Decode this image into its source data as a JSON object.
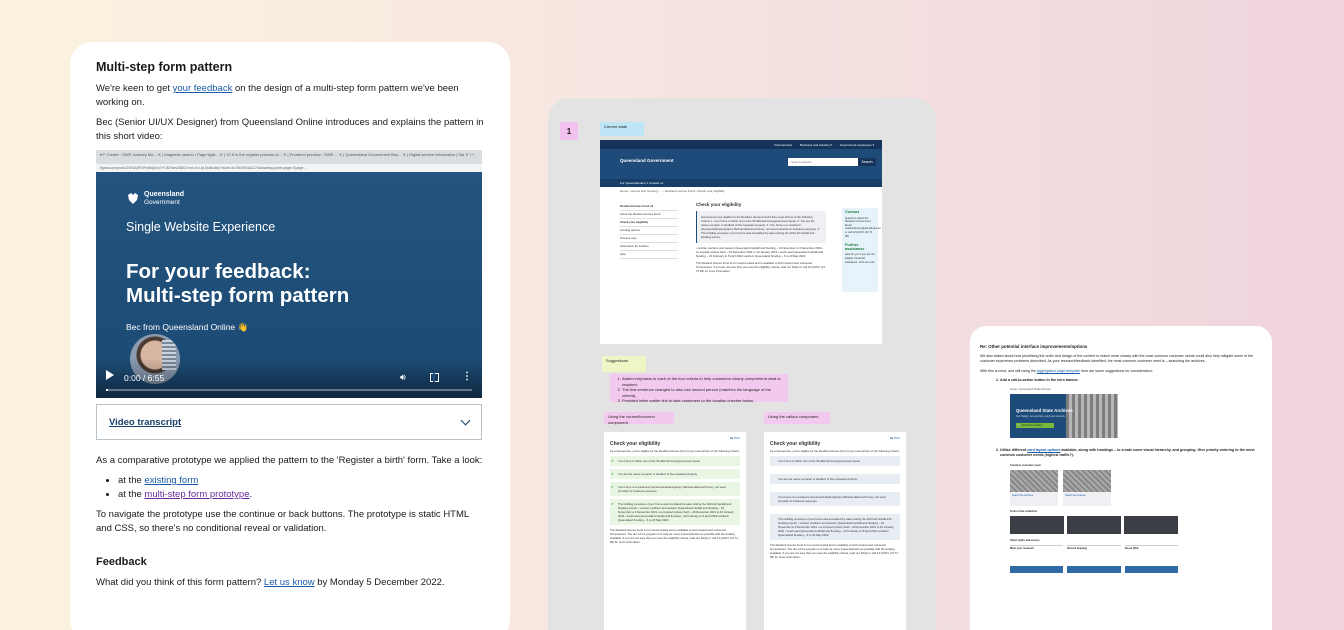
{
  "left_card": {
    "heading": "Multi-step form pattern",
    "intro_before_link": "We're keen to get ",
    "intro_link": "your feedback",
    "intro_after_link": " on the design of a multi-step form pattern we've been working on.",
    "bec_paragraph": "Bec (Senior UI/UX Designer) from Queensland Online introduces and explains the pattern in this short video:",
    "video": {
      "browser_tabs": "▾ F Create - SWE Journey Mo...  ✕ | Magnetic search / Page tight... ✕ | 12 ft in the register process st... ✕ | Frontend preview - SWE ... ✕ | Queensland Government Bus... ✕ | Digital service information | Sta ✕ | +",
      "url": "figma.com/proto/ZSKAQRXlFmtMy2uVVYJ6/Tabs2580-Form-in-Up-Multi-step?node-id=3604%3A1274&starting-point=page=Spage…",
      "crest_name": "Queensland",
      "crest_gov": "Government",
      "subtitle": "Single Website Experience",
      "title_line1": "For your feedback:",
      "title_line2": "Multi-step form pattern",
      "presenter": "Bec from Queensland Online 👋",
      "time": "0:00 / 6:55",
      "progress": 0.0
    },
    "transcript_label": "Video transcript",
    "comparative": "As a comparative prototype we applied the pattern to the 'Register a birth' form. Take a look:",
    "bullets": [
      {
        "prefix": "at the ",
        "link": "existing form",
        "suffix": ""
      },
      {
        "prefix": "at the ",
        "link": "multi-step form prototype",
        "suffix": "."
      }
    ],
    "navigate_text": "To navigate the prototype use the continue or back buttons. The prototype is static HTML and CSS, so there's no conditional reveal or validation.",
    "feedback_heading": "Feedback",
    "feedback_before": "What did you think of this form pattern? ",
    "feedback_link": "Let us know",
    "feedback_after": " by Monday 5 December 2022."
  },
  "board": {
    "step_number": "1",
    "sticky_current": "Current state",
    "site": {
      "top_links": [
        "Find services",
        "Business and industry ▾",
        "Government employees ▾"
      ],
      "logo": "Queensland Government",
      "search_placeholder": "Search website",
      "search_button": "Search",
      "nav": "For Queenslanders ▾     Contact us",
      "breadcrumb": "Home  ›  Homes and housing  ›  ...  ›  Resilient Homes Fund  ›  Check your eligibility",
      "side_items": [
        "Resilient Homes Fund v2",
        "About the Resilient Homes Fund",
        "Check your eligibility",
        "Funding options",
        "Process map",
        "Information for builders",
        "Help"
      ],
      "main_heading": "Check your eligibility",
      "main_info": "Homeowners are eligible for the Resilient Homes Fund if they meet all four of the following criteria: 1. Your home is within one of the 39 affected local government areas. 2. You are the owner-occupier or landlord of the impacted property. 3. Your home is a residence (house/unit/duplex/granny flat/manufactured home), not used primarily for business purposes. 4. The building envelope of your home was inundated by water during the 2021-22 rainfall and flooding events.",
      "main_bullets": "• central, southern and western Queensland rainfall and flooding – 10 November to 3 December 2021 • ex-tropical cyclone Seth – 29 December 2021 to 10 January 2022 • south east Queensland rainfall and flooding – 22 February to 5 April 2022 southern Queensland flooding – 6 to 20 May 2022.",
      "main_footer": "The Resilient Homes Fund is not means tested and is available to both insured and uninsured homeowners. If you are not sure that you meet the eligibility criteria, read our FAQs or call 13 QGOV (13 74 68) for more information.",
      "contact_title": "Contact",
      "contact_text": "Questions about the Resilient Homes Fund. Email resilienthomes@qra.qld.gov.au or call 13 QGOV (13 74 68)",
      "assist_title": "Further assistance",
      "assist_text": "Help for you if you are not eligible. Financial assistance. Find out more"
    },
    "sticky_suggestions": "Suggestions",
    "suggestions": [
      "Added emphasis to each of the four criteria to help customers clearly comprehend what is required.",
      "The first sentence changed to also use second person (matches the language of the criteria).",
      "Provided inline earlier link to take customers to the location checker below."
    ],
    "sticky_correct": "Using the correct/incorrect component",
    "sticky_callout": "Using the callout component",
    "mini_print": "🖶 Print",
    "mini_heading": "Check your eligibility",
    "mini_intro": "As a homeowner, you're eligible for the Resilient Homes Fund if you meet all four of the following criteria:",
    "mini_rows": [
      "Your home is within one of the 39 affected local government areas.",
      "You are the owner-occupier or landlord of the impacted property.",
      "Your home is a residence (house/unit/duplex/granny flat/manufactured home), not used primarily for business purposes.",
      "The building envelope of your home was inundated by water during the 2021-22 rainfall and flooding events: • central, southern and western Queensland rainfall and flooding – 10 November to 3 December 2021 • ex-tropical cyclone Seth – 29 December 2021 to 10 January 2022 • south east Queensland rainfall and flooding – 22 February to 5 April 2022 southern Queensland flooding – 6 to 20 May 2022."
    ],
    "mini_footer": "The Resilient Homes Fund is not means tested and is available to both insured and uninsured homeowners. The aim of the program is to help as many Queenslanders as possible with the funding available. If you are not sure that you meet the eligibility criteria, read our FAQs or call 13 QGOV (13 74 68) for more information."
  },
  "right_card": {
    "heading": "Re: Other potential interface improvements/options",
    "para1": "We also talked about how prioritising the order and design of the content to match more closely with the most common customer needs could also help mitigate some of the customer experience problems described. As your research/feedback identified, the most common customer need is – searching the archives.",
    "para2_before": "With this is mind, and still using the ",
    "para2_link": "Aggregation page template",
    "para2_after": " here are some suggestions for consideration:",
    "item1": "Add a call-to-action button in the hero banner.",
    "banner_breadcrumb": "Home › Queensland State Archives",
    "banner_title": "Queensland State Archives",
    "banner_sub": "Our history, our services, and your records",
    "banner_button": "🔍 Search the archives",
    "item2_before": "Utilise different ",
    "item2_link": "card layout options",
    "item2_after": " available, along with headings – to create some visual hierarchy, and grouping. Give priority ordering to the most common customer needs (highest traffic?).",
    "cards_label": "Common customer need",
    "card1": "Search the archives",
    "card2": "Search the indexes",
    "dark_label": "Tools in the collection",
    "list_label": "Other rights and access",
    "list_cols": [
      "Meet your research",
      "Record keeping",
      "About QSA"
    ]
  }
}
